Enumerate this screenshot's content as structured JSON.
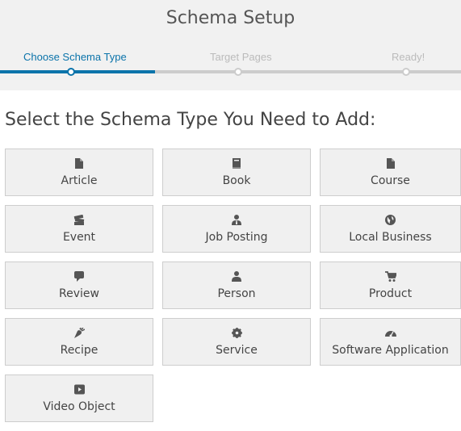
{
  "header": {
    "title": "Schema Setup"
  },
  "steps": [
    {
      "label": "Choose Schema Type"
    },
    {
      "label": "Target Pages"
    },
    {
      "label": "Ready!"
    }
  ],
  "heading": "Select the Schema Type You Need to Add:",
  "cards": [
    {
      "label": "Article",
      "icon": "file-icon"
    },
    {
      "label": "Book",
      "icon": "book-icon"
    },
    {
      "label": "Course",
      "icon": "file-icon"
    },
    {
      "label": "Event",
      "icon": "tickets-icon"
    },
    {
      "label": "Job Posting",
      "icon": "user-tie-icon"
    },
    {
      "label": "Local Business",
      "icon": "globe-icon"
    },
    {
      "label": "Review",
      "icon": "comment-icon"
    },
    {
      "label": "Person",
      "icon": "user-icon"
    },
    {
      "label": "Product",
      "icon": "cart-icon"
    },
    {
      "label": "Recipe",
      "icon": "carrot-icon"
    },
    {
      "label": "Service",
      "icon": "gear-icon"
    },
    {
      "label": "Software Application",
      "icon": "dashboard-icon"
    },
    {
      "label": "Video Object",
      "icon": "video-icon"
    }
  ],
  "colors": {
    "accent": "#0a73aa",
    "inactive": "#cccccc",
    "header_bg": "#f1f1f1",
    "card_bg": "#f0f0f0",
    "icon": "#555555"
  }
}
